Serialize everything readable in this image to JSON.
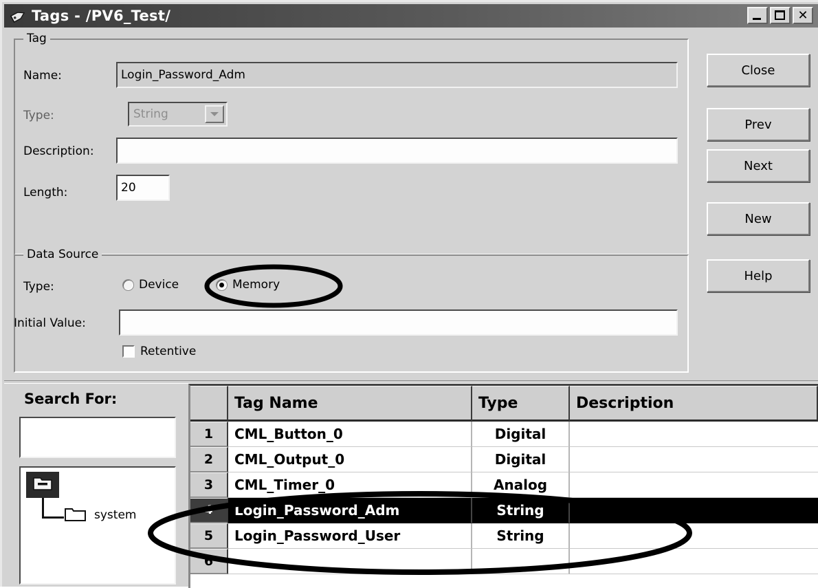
{
  "window": {
    "title": "Tags - /PV6_Test/",
    "icon": "tag-icon",
    "controls": {
      "minimize": "minimize-icon",
      "maximize": "maximize-icon",
      "close": "close-icon"
    }
  },
  "tag_group": {
    "legend": "Tag",
    "name_label": "Name:",
    "name_value": "Login_Password_Adm",
    "type_label": "Type:",
    "type_value": "String",
    "type_disabled": true,
    "description_label": "Description:",
    "description_value": "",
    "length_label": "Length:",
    "length_value": "20"
  },
  "data_source_group": {
    "legend": "Data Source",
    "type_label": "Type:",
    "options": [
      {
        "label": "Device",
        "selected": false
      },
      {
        "label": "Memory",
        "selected": true
      }
    ],
    "initial_value_label": "Initial Value:",
    "initial_value": "",
    "retentive_label": "Retentive",
    "retentive_checked": false
  },
  "buttons": [
    {
      "label": "Close"
    },
    {
      "label": "Prev"
    },
    {
      "label": "Next"
    },
    {
      "label": "New"
    },
    {
      "label": "Help"
    }
  ],
  "search": {
    "label": "Search For:",
    "value": "",
    "tree": {
      "root_icon": "folder-open-minus-icon",
      "root_selected": true,
      "children": [
        {
          "label": "system",
          "icon": "folder-icon"
        }
      ]
    }
  },
  "table": {
    "columns": [
      "",
      "Tag Name",
      "Type",
      "Description"
    ],
    "rows": [
      {
        "num": "1",
        "name": "CML_Button_0",
        "type": "Digital",
        "desc": "",
        "selected": false
      },
      {
        "num": "2",
        "name": "CML_Output_0",
        "type": "Digital",
        "desc": "",
        "selected": false
      },
      {
        "num": "3",
        "name": "CML_Timer_0",
        "type": "Analog",
        "desc": "",
        "selected": false
      },
      {
        "num": "4",
        "name": "Login_Password_Adm",
        "type": "String",
        "desc": "",
        "selected": true
      },
      {
        "num": "5",
        "name": "Login_Password_User",
        "type": "String",
        "desc": "",
        "selected": false
      },
      {
        "num": "6",
        "name": "",
        "type": "",
        "desc": "",
        "selected": false
      }
    ]
  },
  "annotations": [
    {
      "name": "memory-radio-highlight",
      "shape": "ellipse"
    },
    {
      "name": "password-rows-highlight",
      "shape": "ellipse"
    }
  ],
  "colors": {
    "window_bg": "#d3d3d3",
    "title_bar": "#4a4a4a",
    "field_white": "#fdfdfd",
    "field_gray": "#cfcfcf",
    "selection": "#000000",
    "annotation": "#000000"
  }
}
